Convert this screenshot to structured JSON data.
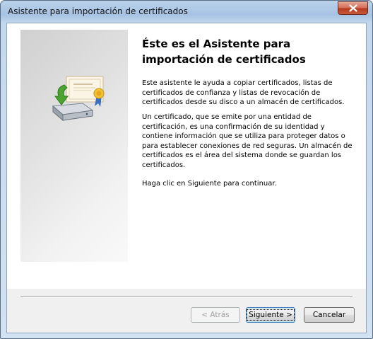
{
  "window": {
    "title": "Asistente para importación de certificados"
  },
  "wizard": {
    "heading": "Éste es el Asistente para importación de certificados",
    "paragraphs": [
      "Este asistente le ayuda a copiar certificados, listas de certificados de confianza y listas de revocación de certificados desde su disco a un almacén de certificados.",
      "Un certificado, que se emite por una entidad de certificación, es una confirmación de su identidad y contiene información que se utiliza para proteger datos o para establecer conexiones de red seguras. Un almacén de certificados es el área del sistema donde se guardan los certificados.",
      "Haga clic en Siguiente para continuar."
    ],
    "icon": "certificate-import-icon"
  },
  "buttons": {
    "back_label": "< Atrás",
    "next_label": "Siguiente >",
    "cancel_label": "Cancelar",
    "back_enabled": false
  },
  "colors": {
    "title_bar": "#b9d1ea",
    "close_button": "#c8472c",
    "default_button_border": "#3c7fb1"
  }
}
